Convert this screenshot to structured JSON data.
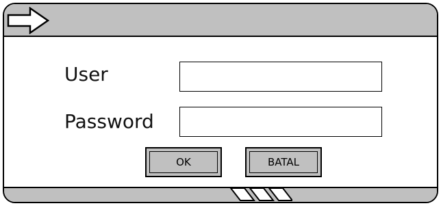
{
  "titlebar": {
    "icon": "arrow-right-icon"
  },
  "form": {
    "user_label": "User",
    "user_value": "",
    "password_label": "Password",
    "password_value": ""
  },
  "buttons": {
    "ok_label": "OK",
    "cancel_label": "BATAL"
  },
  "statusbar": {
    "icon": "resize-grip-icon"
  }
}
